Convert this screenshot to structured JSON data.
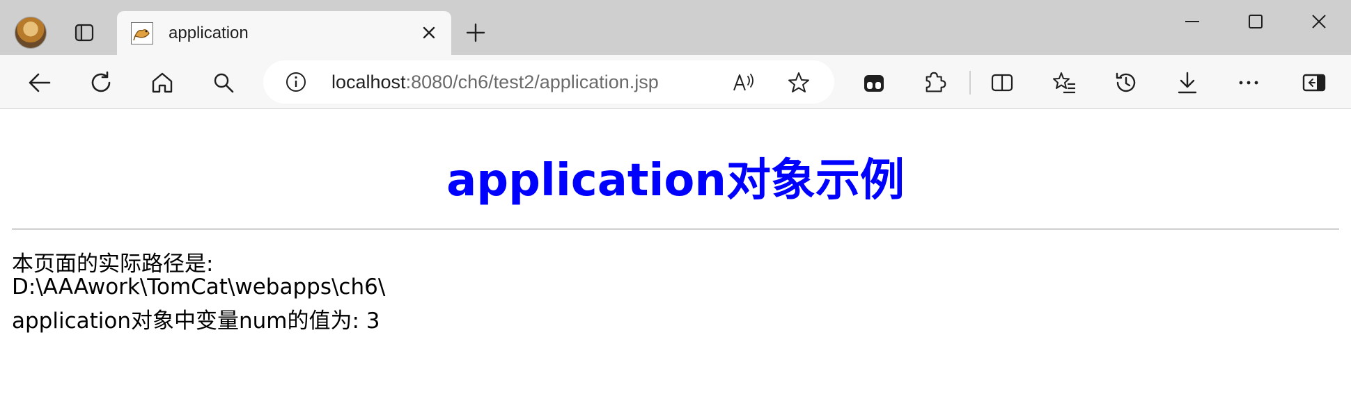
{
  "tab": {
    "title": "application"
  },
  "address": {
    "host": "localhost",
    "rest": ":8080/ch6/test2/application.jsp"
  },
  "page": {
    "heading": "application对象示例",
    "line1": "本页面的实际路径是:",
    "line2": "D:\\AAAwork\\TomCat\\webapps\\ch6\\",
    "line3": "application对象中变量num的值为: 3"
  },
  "colors": {
    "heading": "#0000ff",
    "titlebar": "#cfcfcf",
    "toolbar": "#f7f7f7"
  },
  "icons": [
    "profile-avatar",
    "tab-actions-icon",
    "tomcat-favicon",
    "close-icon",
    "plus-icon",
    "minimize-icon",
    "maximize-icon",
    "window-close-icon",
    "back-icon",
    "refresh-icon",
    "home-icon",
    "search-icon",
    "info-icon",
    "read-aloud-icon",
    "favorite-star-icon",
    "copilot-icon",
    "extensions-icon",
    "split-screen-icon",
    "favorites-icon",
    "history-icon",
    "download-icon",
    "more-icon",
    "sidebar-icon"
  ]
}
